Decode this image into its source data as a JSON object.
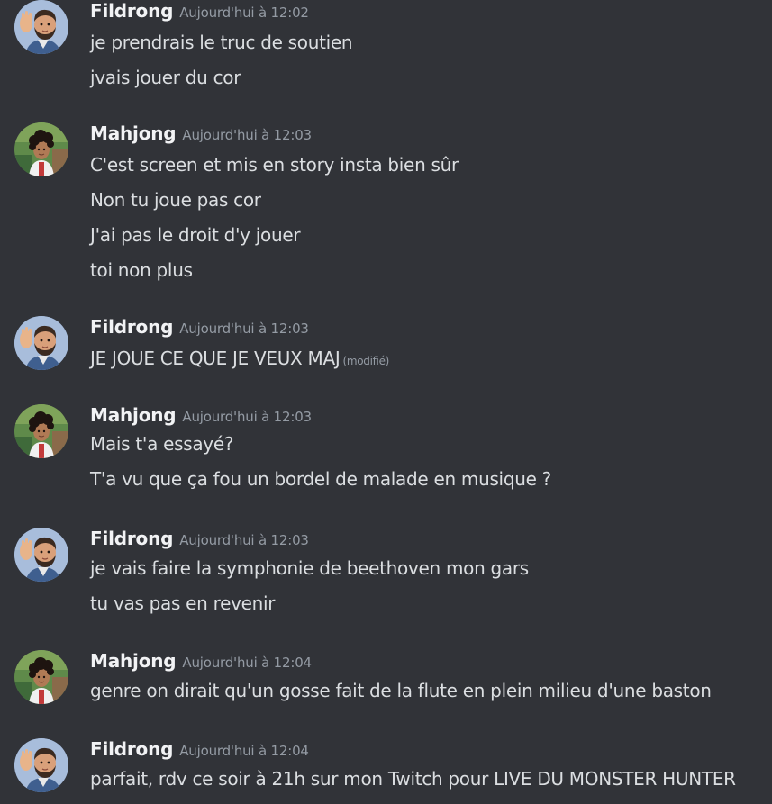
{
  "messages": [
    {
      "author": "Fildrong",
      "avatar_icon": "bearded-man-waving-avatar-icon",
      "timestamp": "Aujourd'hui à 12:02",
      "lines": [
        "je prendrais le truc de soutien",
        "jvais jouer du cor"
      ]
    },
    {
      "author": "Mahjong",
      "avatar_icon": "curly-hair-man-avatar-icon",
      "timestamp": "Aujourd'hui à 12:03",
      "lines": [
        "C'est screen et mis en story insta bien sûr",
        "Non tu joue pas cor",
        "J'ai pas le droit d'y jouer",
        "toi non plus"
      ]
    },
    {
      "author": "Fildrong",
      "avatar_icon": "bearded-man-waving-avatar-icon",
      "timestamp": "Aujourd'hui à 12:03",
      "lines": [
        "JE JOUE CE QUE JE VEUX MAJ"
      ],
      "edited_label": "(modifié)"
    },
    {
      "author": "Mahjong",
      "avatar_icon": "curly-hair-man-avatar-icon",
      "timestamp": "Aujourd'hui à 12:03",
      "lines": [
        "Mais t'a essayé?",
        "T'a vu que ça fou un bordel de malade en musique ?"
      ]
    },
    {
      "author": "Fildrong",
      "avatar_icon": "bearded-man-waving-avatar-icon",
      "timestamp": "Aujourd'hui à 12:03",
      "lines": [
        "je vais faire la symphonie de beethoven mon gars",
        "tu vas pas en revenir"
      ]
    },
    {
      "author": "Mahjong",
      "avatar_icon": "curly-hair-man-avatar-icon",
      "timestamp": "Aujourd'hui à 12:04",
      "lines": [
        "genre on dirait qu'un gosse fait de la flute en plein milieu d'une baston"
      ]
    },
    {
      "author": "Fildrong",
      "avatar_icon": "bearded-man-waving-avatar-icon",
      "timestamp": "Aujourd'hui à 12:04",
      "lines": [
        "parfait, rdv ce soir à 21h sur mon Twitch pour LIVE DU MONSTER HUNTER"
      ]
    }
  ],
  "colors": {
    "background": "#313338",
    "author": "#f2f3f5",
    "text": "#dbdee1",
    "muted": "#949ba4"
  }
}
